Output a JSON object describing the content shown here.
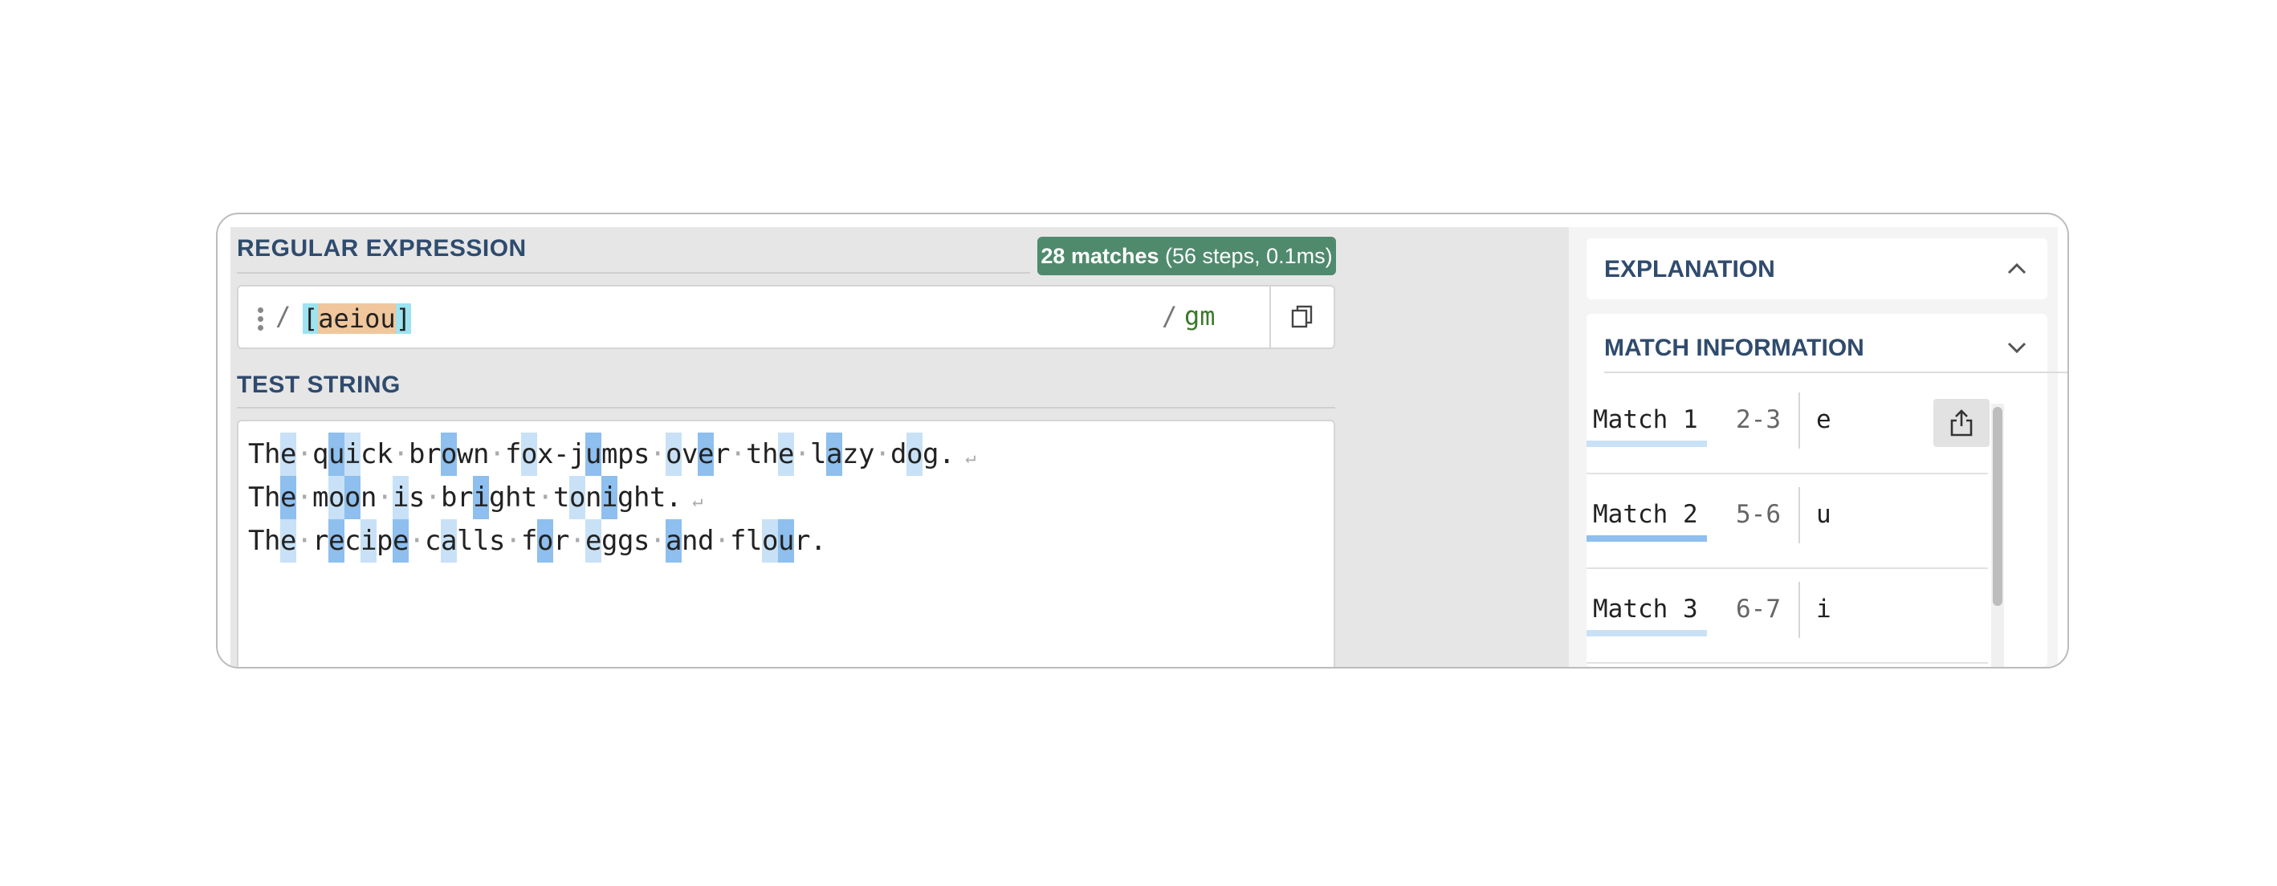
{
  "regex_panel": {
    "title": "REGULAR EXPRESSION",
    "match_count": "28 matches",
    "match_stats": "(56 steps, 0.1ms)",
    "delimiter_open": "/",
    "pattern_open_bracket": "[",
    "pattern_chars": "aeiou",
    "pattern_close_bracket": "]",
    "delimiter_close": "/",
    "flags": "gm"
  },
  "test_panel": {
    "title": "TEST STRING",
    "lines": [
      "The quick brown fox-jumps over the lazy dog.",
      "The moon is bright tonight.",
      "The recipe calls for eggs and flour."
    ]
  },
  "explanation_panel": {
    "title": "EXPLANATION"
  },
  "match_info_panel": {
    "title": "MATCH INFORMATION",
    "matches": [
      {
        "label": "Match 1",
        "range": "2-3",
        "value": "e"
      },
      {
        "label": "Match 2",
        "range": "5-6",
        "value": "u"
      },
      {
        "label": "Match 3",
        "range": "6-7",
        "value": "i"
      }
    ]
  },
  "icons": {
    "menu": "kebab-icon",
    "copy": "copy-icon",
    "collapse": "chevron-up-icon",
    "expand": "chevron-down-icon",
    "share": "share-icon",
    "whitespace": "space-dot-icon",
    "newline": "newline-icon"
  },
  "colors": {
    "title": "#2f4b6d",
    "badge": "#4f8a6d",
    "flags": "#3a7a2a",
    "bracket_highlight": "#9de3f0",
    "chars_highlight": "#f0c79d",
    "match_highlight_a": "#c8e1f6",
    "match_highlight_b": "#8ebfee"
  }
}
